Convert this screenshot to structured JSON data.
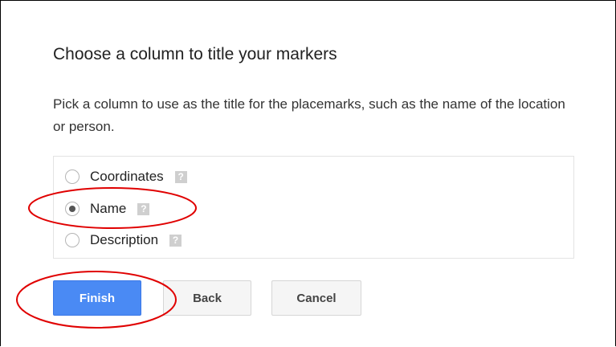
{
  "dialog": {
    "title": "Choose a column to title your markers",
    "description": "Pick a column to use as the title for the placemarks, such as the name of the location or person.",
    "options": [
      {
        "label": "Coordinates",
        "checked": false,
        "help_icon": "question-mark-icon"
      },
      {
        "label": "Name",
        "checked": true,
        "help_icon": "question-mark-icon"
      },
      {
        "label": "Description",
        "checked": false,
        "help_icon": "question-mark-icon"
      }
    ],
    "help_glyph": "?",
    "buttons": {
      "finish": "Finish",
      "back": "Back",
      "cancel": "Cancel"
    }
  },
  "colors": {
    "primary_button": "#4a8af4",
    "annotation_red": "#e00000"
  }
}
